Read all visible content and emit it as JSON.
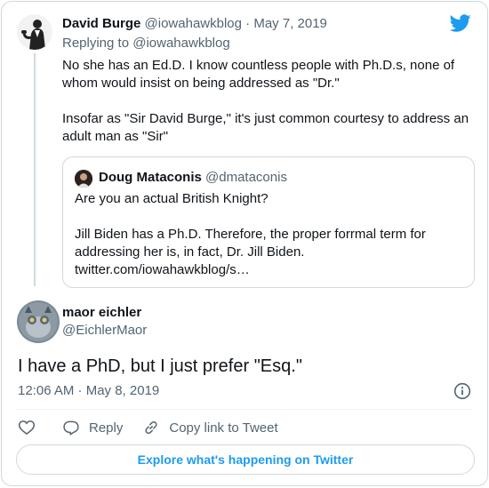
{
  "colors": {
    "brand": "#1d9bf0",
    "text": "#0f1419",
    "muted": "#536471",
    "border": "#cfd9de"
  },
  "parent_tweet": {
    "name": "David Burge",
    "handle": "@iowahawkblog",
    "separator": "·",
    "date": "May 7, 2019",
    "replying_prefix": "Replying to",
    "replying_handle": "@iowahawkblog",
    "text_paragraphs": [
      "No she has an Ed.D. I know countless people with Ph.D.s, none of whom would insist on being addressed as \"Dr.\"",
      "Insofar as \"Sir David Burge,\" it's just common courtesy to address an adult man as \"Sir\""
    ]
  },
  "quoted_tweet": {
    "name": "Doug Mataconis",
    "handle": "@dmataconis",
    "text_paragraphs": [
      "Are you an actual British Knight?",
      "Jill Biden has a Ph.D. Therefore, the proper forrmal term for addressing her is, in fact, Dr. Jill Biden.\ntwitter.com/iowahawkblog/s…"
    ]
  },
  "main_tweet": {
    "name": "maor eichler",
    "handle": "@EichlerMaor",
    "text": "I have a PhD, but I just prefer \"Esq.\"",
    "timestamp": "12:06 AM · May 8, 2019"
  },
  "actions": {
    "like_icon": "heart-icon",
    "reply_label": "Reply",
    "copy_label": "Copy link to Tweet"
  },
  "explore_label": "Explore what's happening on Twitter"
}
